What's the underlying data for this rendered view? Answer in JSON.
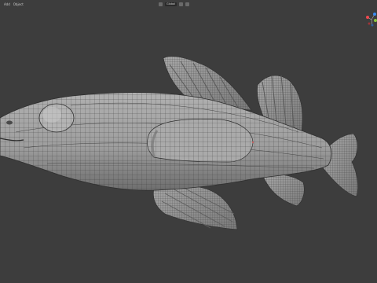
{
  "header": {
    "menu": [
      {
        "label": "Add"
      },
      {
        "label": "Object"
      }
    ],
    "orientation_label": "Global"
  },
  "gizmo": {
    "axes": [
      {
        "name": "x-axis",
        "color": "#f0484e"
      },
      {
        "name": "y-axis",
        "color": "#8cc63e"
      },
      {
        "name": "z-axis",
        "color": "#3d8bf0"
      }
    ]
  },
  "colors": {
    "background": "#3d3d3d",
    "mesh": "#9c9c9c",
    "wire": "#2e2e2e"
  },
  "icons": [
    "transform-orientation-icon",
    "snap-icon",
    "proportional-editing-icon",
    "viewport-gizmo-icon"
  ]
}
